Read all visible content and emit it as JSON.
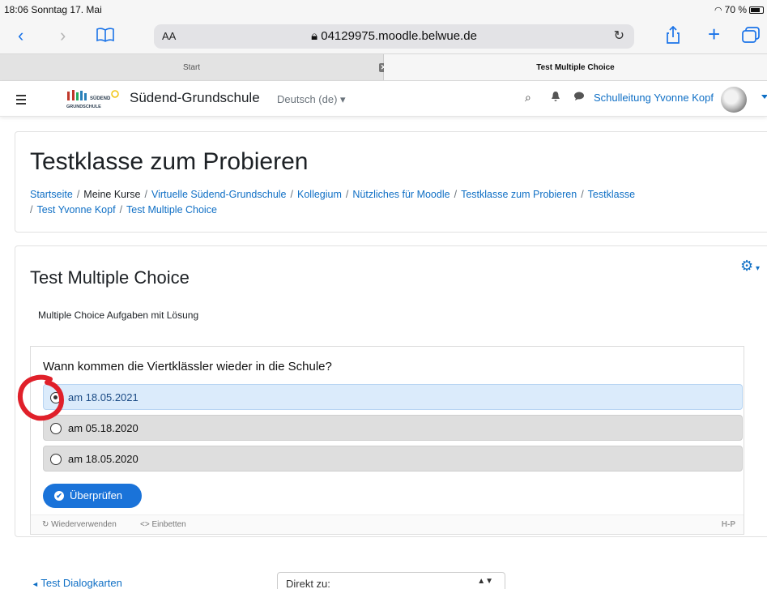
{
  "status_bar": {
    "time_date": "18:06  Sonntag 17. Mai",
    "battery": "70 %"
  },
  "browser": {
    "aa_label": "AA",
    "url": "04129975.moodle.belwue.de",
    "tabs": [
      {
        "label": "Start"
      },
      {
        "label": "Test Multiple Choice"
      }
    ]
  },
  "navbar": {
    "site_name": "Südend-Grundschule",
    "language": "Deutsch (de)",
    "user_name": "Schulleitung Yvonne Kopf"
  },
  "header": {
    "course_title": "Testklasse zum Probieren",
    "breadcrumb": [
      "Startseite",
      "Meine Kurse",
      "Virtuelle Südend-Grundschule",
      "Kollegium",
      "Nützliches für Moodle",
      "Testklasse zum Probieren",
      "Testklasse",
      "Test Yvonne Kopf",
      "Test Multiple Choice"
    ],
    "breadcrumb_sep": "/"
  },
  "activity": {
    "title": "Test Multiple Choice",
    "intro": "Multiple Choice Aufgaben mit Lösung",
    "question": "Wann kommen die Viertklässler wieder in die Schule?",
    "answers": [
      {
        "text": "am 18.05.2021",
        "selected": true
      },
      {
        "text": "am 05.18.2020",
        "selected": false
      },
      {
        "text": "am 18.05.2020",
        "selected": false
      }
    ],
    "check_button": "Überprüfen",
    "footer": {
      "reuse": "Wiederverwenden",
      "embed": "Einbetten",
      "h5p_logo": "H-P"
    }
  },
  "bottom_nav": {
    "prev_link": "Test Dialogkarten",
    "jump_label": "Direkt zu:"
  },
  "colors": {
    "link_blue": "#0f6fc5",
    "button_blue": "#1a73d9",
    "selected_bg": "#dbebfb",
    "annotation_red": "#e0202a"
  }
}
